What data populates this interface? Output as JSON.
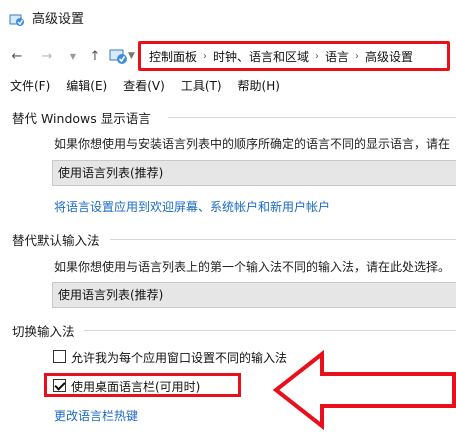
{
  "window": {
    "title": "高级设置",
    "icon": "control-panel-icon"
  },
  "nav": {
    "back": "←",
    "forward": "→",
    "recent_dropdown": "▼",
    "up": "↑",
    "address_dropdown": "▼"
  },
  "address": {
    "crumbs": [
      "控制面板",
      "时钟、语言和区域",
      "语言",
      "高级设置"
    ],
    "separator": "›",
    "highlight_color": "#e8101a"
  },
  "menu": [
    "文件(F)",
    "编辑(E)",
    "查看(V)",
    "工具(T)",
    "帮助(H)"
  ],
  "display_language": {
    "title": "替代 Windows 显示语言",
    "description": "如果你想使用与安装语言列表中的顺序所确定的语言不同的显示语言，请在",
    "select_value": "使用语言列表(推荐)",
    "link": "将语言设置应用到欢迎屏幕、系统帐户和新用户帐户"
  },
  "default_input": {
    "title": "替代默认输入法",
    "description": "如果你想使用与语言列表上的第一个输入法不同的输入法，请在此处选择。",
    "select_value": "使用语言列表(推荐)"
  },
  "switch_input": {
    "title": "切换输入法",
    "option1": {
      "label": "允许我为每个应用窗口设置不同的输入法",
      "checked": false
    },
    "option2": {
      "label": "使用桌面语言栏(可用时)",
      "checked": true
    },
    "link": "更改语言栏热键"
  },
  "colors": {
    "accent_red": "#e8101a",
    "link_blue": "#1a6ac4"
  }
}
